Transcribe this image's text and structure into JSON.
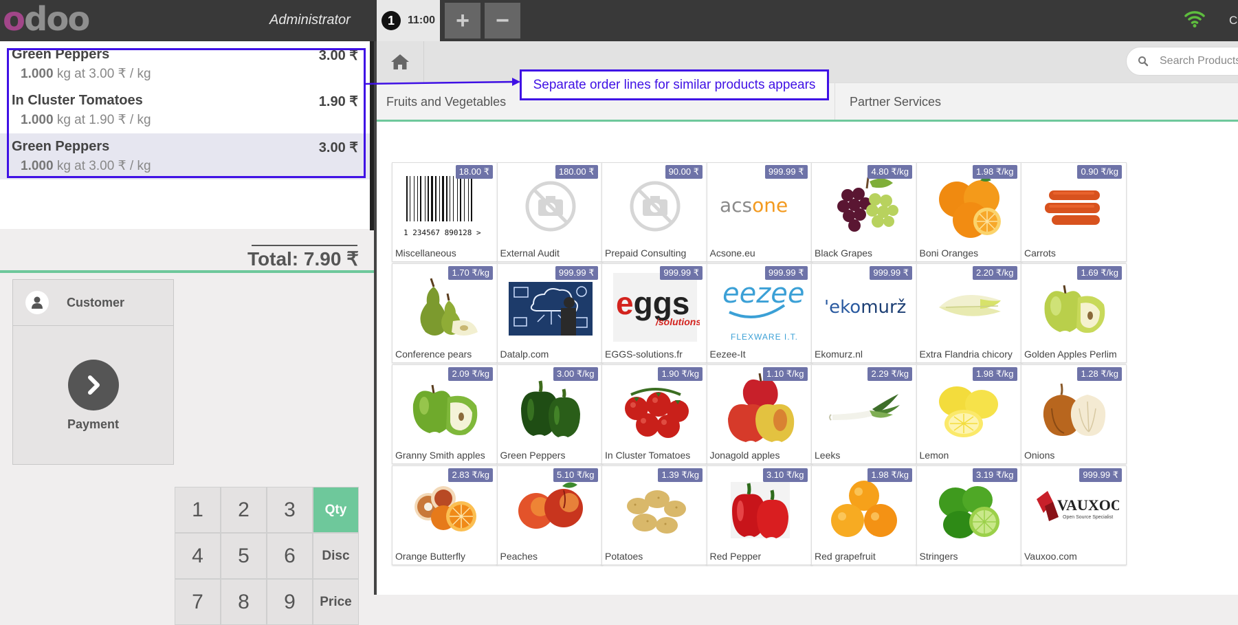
{
  "header": {
    "logo": "odoo",
    "cashier": "Administrator",
    "order_number": "1",
    "order_time": "11:00",
    "add_order": "+",
    "remove_order": "−",
    "close_label": "Cl"
  },
  "order": {
    "lines": [
      {
        "name": "Green Peppers",
        "price": "3.00 ₹",
        "qty": "1.000",
        "detail": "kg at 3.00 ₹ / kg"
      },
      {
        "name": "In Cluster Tomatoes",
        "price": "1.90 ₹",
        "qty": "1.000",
        "detail": "kg at 1.90 ₹ / kg"
      },
      {
        "name": "Green Peppers",
        "price": "3.00 ₹",
        "qty": "1.000",
        "detail": "kg at 3.00 ₹ / kg"
      }
    ],
    "total": "Total: 7.90 ₹"
  },
  "actions": {
    "customer": "Customer",
    "payment": "Payment"
  },
  "numpad": {
    "keys": [
      "1",
      "2",
      "3",
      "4",
      "5",
      "6",
      "7",
      "8",
      "9"
    ],
    "qty": "Qty",
    "disc": "Disc",
    "price": "Price"
  },
  "search": {
    "placeholder": "Search Products"
  },
  "categories": [
    "Fruits and Vegetables",
    "Partner Services"
  ],
  "annotation": "Separate order lines for similar products appears",
  "products": [
    {
      "name": "Miscellaneous",
      "price": "18.00 ₹",
      "icon": "barcode",
      "barcode_digits": "1 234567 890128 >"
    },
    {
      "name": "External Audit",
      "price": "180.00 ₹",
      "icon": "no-photo"
    },
    {
      "name": "Prepaid Consulting",
      "price": "90.00 ₹",
      "icon": "no-photo"
    },
    {
      "name": "Acsone.eu",
      "price": "999.99 ₹",
      "icon": "logo",
      "logo_text": "acsone"
    },
    {
      "name": "Black Grapes",
      "price": "4.80 ₹/kg",
      "icon": "grapes"
    },
    {
      "name": "Boni Oranges",
      "price": "1.98 ₹/kg",
      "icon": "orange"
    },
    {
      "name": "Carrots",
      "price": "0.90 ₹/kg",
      "icon": "carrots"
    },
    {
      "name": "Conference pears",
      "price": "1.70 ₹/kg",
      "icon": "pear"
    },
    {
      "name": "Datalp.com",
      "price": "999.99 ₹",
      "icon": "datalp"
    },
    {
      "name": "EGGS-solutions.fr",
      "price": "999.99 ₹",
      "icon": "logo",
      "logo_text": "eggs",
      "logo_sub": "/solutions"
    },
    {
      "name": "Eezee-It",
      "price": "999.99 ₹",
      "icon": "logo",
      "logo_text": "eezee",
      "logo_sub": "FLEXWARE I.T."
    },
    {
      "name": "Ekomurz.nl",
      "price": "999.99 ₹",
      "icon": "logo",
      "logo_text": "'ekomurž"
    },
    {
      "name": "Extra Flandria chicory",
      "price": "2.20 ₹/kg",
      "icon": "chicory"
    },
    {
      "name": "Golden Apples Perlim",
      "price": "1.69 ₹/kg",
      "icon": "golden-apple"
    },
    {
      "name": "Granny Smith apples",
      "price": "2.09 ₹/kg",
      "icon": "green-apple"
    },
    {
      "name": "Green Peppers",
      "price": "3.00 ₹/kg",
      "icon": "green-pepper"
    },
    {
      "name": "In Cluster Tomatoes",
      "price": "1.90 ₹/kg",
      "icon": "tomato"
    },
    {
      "name": "Jonagold apples",
      "price": "1.10 ₹/kg",
      "icon": "red-apple"
    },
    {
      "name": "Leeks",
      "price": "2.29 ₹/kg",
      "icon": "leek"
    },
    {
      "name": "Lemon",
      "price": "1.98 ₹/kg",
      "icon": "lemon"
    },
    {
      "name": "Onions",
      "price": "1.28 ₹/kg",
      "icon": "onion"
    },
    {
      "name": "Orange Butterfly",
      "price": "2.83 ₹/kg",
      "icon": "orange-butterfly"
    },
    {
      "name": "Peaches",
      "price": "5.10 ₹/kg",
      "icon": "peach"
    },
    {
      "name": "Potatoes",
      "price": "1.39 ₹/kg",
      "icon": "potato"
    },
    {
      "name": "Red Pepper",
      "price": "3.10 ₹/kg",
      "icon": "red-pepper"
    },
    {
      "name": "Red grapefruit",
      "price": "1.98 ₹/kg",
      "icon": "grapefruit"
    },
    {
      "name": "Stringers",
      "price": "3.19 ₹/kg",
      "icon": "lime"
    },
    {
      "name": "Vauxoo.com",
      "price": "999.99 ₹",
      "icon": "logo",
      "logo_text": "VAUXOO",
      "logo_sub": "Open Source Specialist"
    }
  ],
  "colors": {
    "accent_green": "#6ec89b",
    "price_badge": "#6e73a8",
    "annotation": "#3f10e5",
    "topbar": "#393939",
    "odoo_purple": "#a24689"
  }
}
